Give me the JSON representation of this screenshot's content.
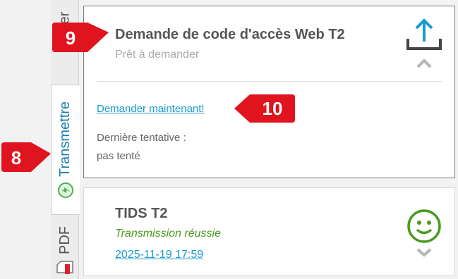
{
  "tabs": {
    "top_label": "er",
    "transmit_label": "Transmettre",
    "pdf_label": "PDF"
  },
  "card_main": {
    "title": "Demande de code d'accès Web T2",
    "status": "Prêt à demander",
    "action_link": "Demander maintenant!",
    "last_attempt_label": "Dernière tentative :",
    "last_attempt_value": "pas tenté",
    "icon": "upload-tray-icon"
  },
  "card_second": {
    "title": "TIDS T2",
    "status": "Transmission réussie",
    "timestamp": "2025-11-19 17:59",
    "icon": "smiley-icon"
  },
  "callouts": {
    "c8": "8",
    "c9": "9",
    "c10": "10"
  },
  "colors": {
    "accent_blue": "#1b9bd1",
    "success_green": "#4a9b1f",
    "callout_red": "#e0141e",
    "error_red": "#d9232d"
  }
}
